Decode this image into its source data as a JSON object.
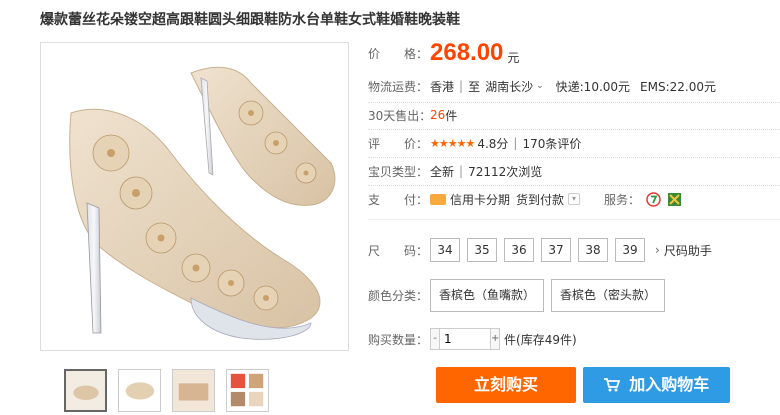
{
  "product": {
    "title": "爆款蕾丝花朵镂空超高跟鞋圆头细跟鞋防水台单鞋女式鞋婚鞋晚装鞋"
  },
  "price": {
    "label": "价　　格：",
    "value": "268.00",
    "unit": "元"
  },
  "shipping": {
    "label": "物流运费：",
    "from": "香港",
    "to_prefix": "至",
    "to": "湖南长沙",
    "express": "快递:10.00元",
    "ems": "EMS:22.00元"
  },
  "sales": {
    "label": "30天售出：",
    "count": "26",
    "unit": "件"
  },
  "rating": {
    "label": "评　　价：",
    "stars": "★★★★★",
    "score": "4.8分",
    "reviews": "170条评价"
  },
  "item_type": {
    "label": "宝贝类型：",
    "condition": "全新",
    "views": "72112次浏览"
  },
  "payment": {
    "label": "支　　付：",
    "card": "信用卡分期",
    "cod": "货到付款",
    "service_label": "服务："
  },
  "size": {
    "label": "尺　　码：",
    "options": [
      "34",
      "35",
      "36",
      "37",
      "38",
      "39"
    ],
    "helper": "尺码助手"
  },
  "color": {
    "label": "颜色分类：",
    "options": [
      "香槟色（鱼嘴款）",
      "香槟色（密头款）"
    ]
  },
  "quantity": {
    "label": "购买数量：",
    "value": "1",
    "minus": "-",
    "plus": "+",
    "unit": "件",
    "stock": "(库存49件)"
  },
  "actions": {
    "buy": "立刻购买",
    "cart": "加入购物车"
  },
  "colors": {
    "accent": "#ff4400",
    "buy": "#ff6600",
    "cart": "#2e9be4"
  }
}
